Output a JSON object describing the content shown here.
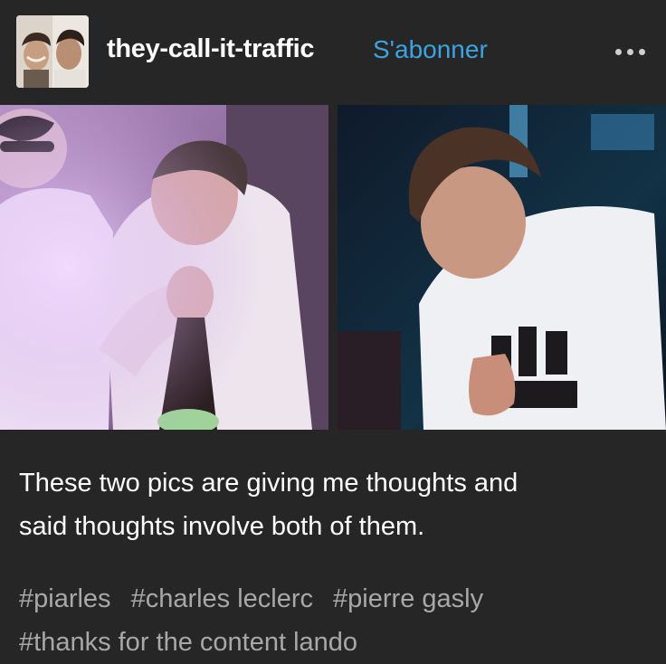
{
  "post": {
    "blog_name": "they-call-it-traffic",
    "follow_label": "S'abonner",
    "more_icon": "ellipsis-icon",
    "avatar_description": "avatar",
    "caption_lines": [
      "These two pics are giving me thoughts and",
      "said thoughts involve both of them."
    ],
    "tags": [
      "#piarles",
      "#charles leclerc",
      "#pierre gasly",
      "#thanks for the content lando"
    ]
  },
  "colors": {
    "background": "#262626",
    "text": "#ffffff",
    "follow_link": "#3aa3e3",
    "tags": "#a8a8a8"
  }
}
